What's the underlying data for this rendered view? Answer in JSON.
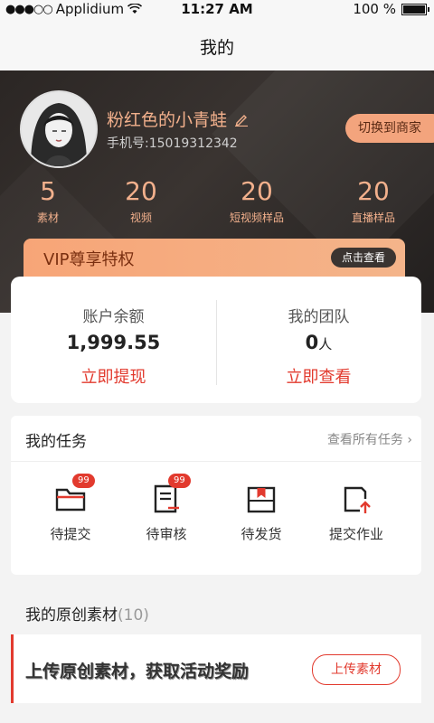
{
  "status_bar": {
    "carrier": "Applidium",
    "time": "11:27 AM",
    "battery": "100 %"
  },
  "nav": {
    "title": "我的"
  },
  "profile": {
    "name": "粉红色的小青蛙",
    "phone": "手机号:15019312342",
    "switch_label": "切换到商家"
  },
  "stats": [
    {
      "value": "5",
      "label": "素材"
    },
    {
      "value": "20",
      "label": "视频"
    },
    {
      "value": "20",
      "label": "短视频样品"
    },
    {
      "value": "20",
      "label": "直播样品"
    }
  ],
  "vip": {
    "title": "VIP尊享特权",
    "button": "点击查看"
  },
  "balance": {
    "account_title": "账户余额",
    "account_value": "1,999.55",
    "account_action": "立即提现",
    "team_title": "我的团队",
    "team_value": "0",
    "team_unit": "人",
    "team_action": "立即查看"
  },
  "tasks": {
    "title": "我的任务",
    "more": "查看所有任务",
    "items": [
      {
        "label": "待提交",
        "badge": "99",
        "icon": "folder-icon"
      },
      {
        "label": "待审核",
        "badge": "99",
        "icon": "document-icon"
      },
      {
        "label": "待发货",
        "badge": "",
        "icon": "package-icon"
      },
      {
        "label": "提交作业",
        "badge": "",
        "icon": "upload-icon"
      }
    ]
  },
  "original": {
    "title": "我的原创素材",
    "count": "(10)",
    "banner_text": "上传原创素材，获取活动奖励",
    "upload_button": "上传素材"
  },
  "colors": {
    "accent": "#e23a2e",
    "gold": "#f2b08c",
    "vip": "#f7a577",
    "dark": "#2b2624"
  }
}
